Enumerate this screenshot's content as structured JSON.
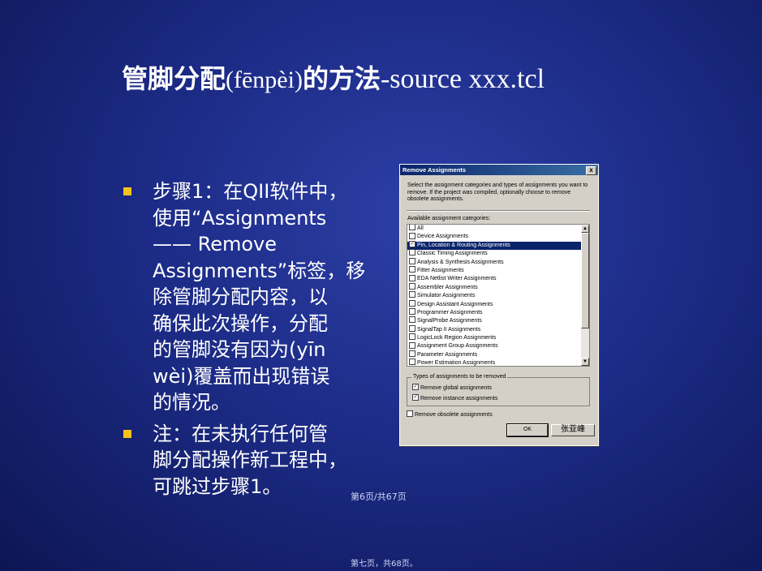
{
  "title": {
    "cn": "管脚分配",
    "pinyin": "(fēnpèi)",
    "cn2": "的方法",
    "tail": "-source xxx.tcl"
  },
  "bullets": [
    {
      "lines": [
        [
          "步骤1：在QII软件中，"
        ],
        [
          "使用“Assignments"
        ],
        [
          "—— Remove"
        ],
        [
          "Assignments”标签，移"
        ],
        [
          "除管脚分配内容，以"
        ],
        [
          "确保此次操作，分配"
        ],
        [
          "的管脚没有因为(yīn"
        ],
        [
          "wèi)覆盖而出现错误"
        ],
        [
          "的情况。"
        ]
      ]
    },
    {
      "lines": [
        [
          "注：在未执行任何管"
        ],
        [
          "脚分配操作新工程中，"
        ],
        [
          "可跳过步骤1。"
        ]
      ]
    }
  ],
  "page_indicator": "第6页/共67页",
  "footer": "第七页，共68页。",
  "dialog": {
    "title": "Remove Assignments",
    "close": "x",
    "description": "Select the assignment categories and types of assignments you want to remove. If the project was compiled, optionally choose to remove obsolete assignments.",
    "list_label": "Available assignment categories:",
    "items": [
      {
        "label": "All",
        "checked": false,
        "selected": false
      },
      {
        "label": "Device Assignments",
        "checked": false,
        "selected": false
      },
      {
        "label": "Pin, Location & Routing Assignments",
        "checked": true,
        "selected": true
      },
      {
        "label": "Classic Timing Assignments",
        "checked": false,
        "selected": false
      },
      {
        "label": "Analysis & Synthesis Assignments",
        "checked": false,
        "selected": false
      },
      {
        "label": "Fitter Assignments",
        "checked": false,
        "selected": false
      },
      {
        "label": "EDA Netlist Writer Assignments",
        "checked": false,
        "selected": false
      },
      {
        "label": "Assembler Assignments",
        "checked": false,
        "selected": false
      },
      {
        "label": "Simulator Assignments",
        "checked": false,
        "selected": false
      },
      {
        "label": "Design Assistant Assignments",
        "checked": false,
        "selected": false
      },
      {
        "label": "Programmer Assignments",
        "checked": false,
        "selected": false
      },
      {
        "label": "SignalProbe Assignments",
        "checked": false,
        "selected": false
      },
      {
        "label": "SignalTap II Assignments",
        "checked": false,
        "selected": false
      },
      {
        "label": "LogicLock Region Assignments",
        "checked": false,
        "selected": false
      },
      {
        "label": "Assignment Group Assignments",
        "checked": false,
        "selected": false
      },
      {
        "label": "Parameter Assignments",
        "checked": false,
        "selected": false
      },
      {
        "label": "Power Estimation Assignments",
        "checked": false,
        "selected": false
      }
    ],
    "types_label": "Types of assignments to be removed",
    "global_label": "Remove global assignments",
    "instance_label": "Remove instance assignments",
    "obsolete_label": "Remove obsolete assignments",
    "ok_label": "OK",
    "cancel_label": "张亚峰"
  }
}
